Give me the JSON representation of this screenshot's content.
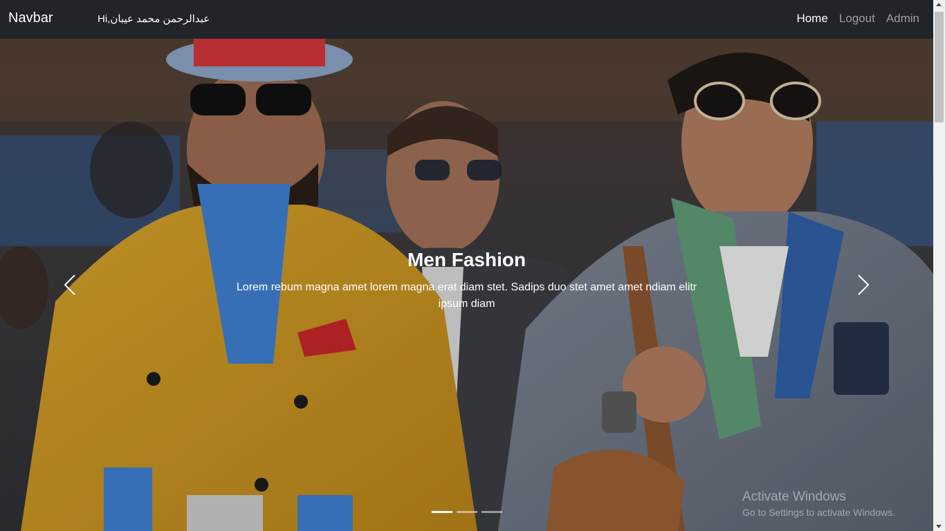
{
  "navbar": {
    "brand": "Navbar",
    "greeting": "Hi,عبدالرحمن محمد عيبان",
    "links": [
      {
        "label": "Home",
        "active": true
      },
      {
        "label": "Logout",
        "active": false
      },
      {
        "label": "Admin",
        "active": false
      }
    ]
  },
  "carousel": {
    "caption_title": "Men Fashion",
    "caption_text": "Lorem rebum magna amet lorem magna erat diam stet. Sadips duo stet amet amet ndiam elitr ipsum diam",
    "prev_icon": "chevron-left-icon",
    "next_icon": "chevron-right-icon",
    "slide_count": 3,
    "active_index": 0
  },
  "watermark": {
    "title": "Activate Windows",
    "subtitle": "Go to Settings to activate Windows."
  },
  "colors": {
    "navbar_bg": "#212529",
    "nav_active": "#ffffff",
    "nav_inactive": "#8c8e91"
  }
}
